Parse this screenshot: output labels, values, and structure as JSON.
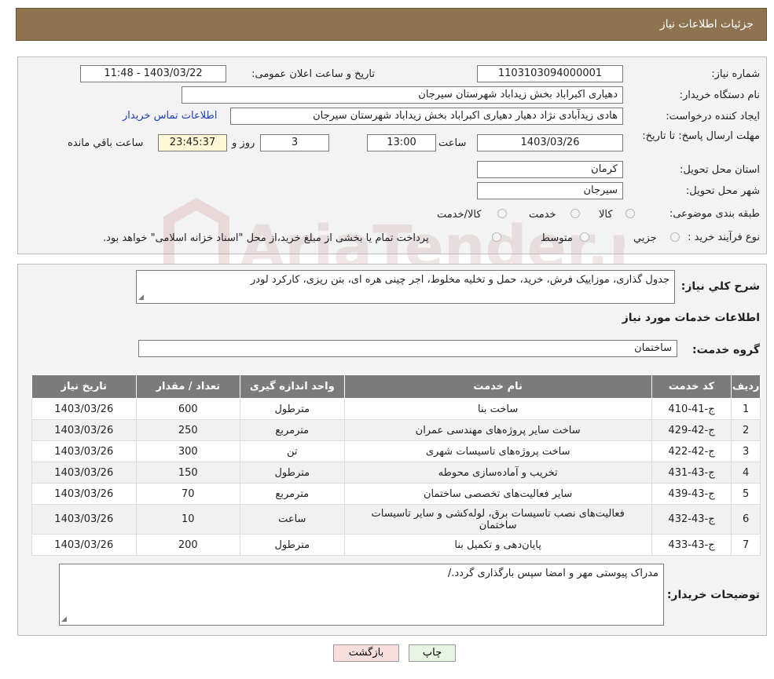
{
  "header": {
    "title": "جزئیات اطلاعات نیاز"
  },
  "labels": {
    "need_no": "شماره نیاز:",
    "announce_dt": "تاریخ و ساعت اعلان عمومی:",
    "buyer_org": "نام دستگاه خریدار:",
    "requester": "ایجاد کننده درخواست:",
    "contact_link": "اطلاعات تماس خریدار",
    "deadline": "مهلت ارسال پاسخ: تا تاریخ:",
    "time_word": "ساعت",
    "days_and": "روز و",
    "remaining": "ساعت باقي مانده",
    "province": "استان محل تحویل:",
    "city": "شهر محل تحویل:",
    "category": "طبقه بندی موضوعی:",
    "process": "نوع فرآیند خرید :",
    "summary": "شرح کلي نياز:",
    "services_title": "اطلاعات خدمات مورد نیاز",
    "service_group": "گروه خدمت:",
    "buyer_notes": "توضیحات خریدار:"
  },
  "values": {
    "need_no": "1103103094000001",
    "announce_dt": "1403/03/22 - 11:48",
    "buyer_org": "دهیاری اکبراباد بخش زیداباد شهرستان سیرجان",
    "requester": "هادی زیدآبادی نژاد دهیار دهیاری اکبراباد بخش زیداباد شهرستان سیرجان",
    "deadline_date": "1403/03/26",
    "deadline_time": "13:00",
    "days": "3",
    "countdown": "23:45:37",
    "province": "کرمان",
    "city": "سیرجان",
    "summary": "جدول گذاری، موزاییک فرش، خرید، حمل و تخلیه مخلوط، اجر چینی هره ای، بتن ریزی، کارکرد لودر",
    "service_group": "ساختمان",
    "buyer_notes": "مدراک پیوستی مهر و امضا سپس بارگذاری گردد./"
  },
  "category_options": [
    "کالا",
    "خدمت",
    "کالا/خدمت"
  ],
  "process_options": [
    "جزیي",
    "متوسط"
  ],
  "process_note": "پرداخت تمام یا بخشی از مبلغ خرید،از محل \"اسناد خزانه اسلامی\" خواهد بود.",
  "table": {
    "headers": [
      "ردیف",
      "کد خدمت",
      "نام خدمت",
      "واحد اندازه گیری",
      "تعداد / مقدار",
      "تاریخ نیاز"
    ],
    "rows": [
      [
        "1",
        "ج-41-410",
        "ساخت بنا",
        "مترطول",
        "600",
        "1403/03/26"
      ],
      [
        "2",
        "ج-42-429",
        "ساخت سایر پروژه‌های مهندسی عمران",
        "مترمربع",
        "250",
        "1403/03/26"
      ],
      [
        "3",
        "ج-42-422",
        "ساخت پروژه‌های تاسیسات شهری",
        "تن",
        "300",
        "1403/03/26"
      ],
      [
        "4",
        "ج-43-431",
        "تخریب و آماده‌سازی محوطه",
        "مترطول",
        "150",
        "1403/03/26"
      ],
      [
        "5",
        "ج-43-439",
        "سایر فعالیت‌های تخصصی ساختمان",
        "مترمربع",
        "70",
        "1403/03/26"
      ],
      [
        "6",
        "ج-43-432",
        "فعالیت‌های نصب تاسیسات برق، لوله‌کشی و سایر تاسیسات ساختمان",
        "ساعت",
        "10",
        "1403/03/26"
      ],
      [
        "7",
        "ج-43-433",
        "پایان‌دهی و تکمیل بنا",
        "مترطول",
        "200",
        "1403/03/26"
      ]
    ]
  },
  "buttons": {
    "print": "چاپ",
    "back": "بازگشت"
  },
  "watermark": {
    "text": "AriaTender.neT"
  }
}
